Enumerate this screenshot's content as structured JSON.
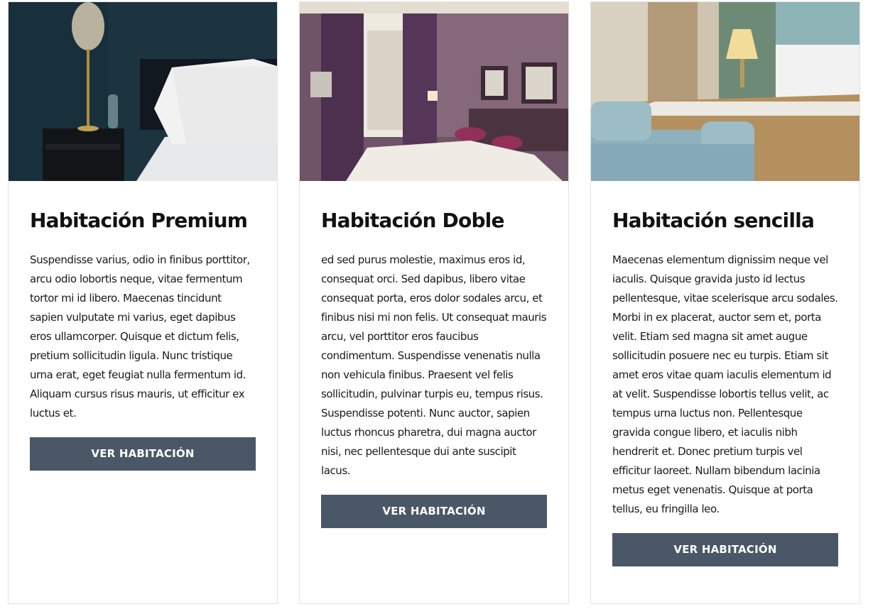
{
  "rooms": [
    {
      "title": "Habitación Premium",
      "description": "Suspendisse varius, odio in finibus porttitor, arcu odio lobortis neque, vitae fermentum tortor mi id libero. Maecenas tincidunt sapien vulputate mi varius, eget dapibus eros ullamcorper. Quisque et dictum felis, pretium sollicitudin ligula. Nunc tristique urna erat, eget feugiat nulla fermentum id. Aliquam cursus risus mauris, ut efficitur ex luctus et.",
      "button_label": "VER HABITACIÓN",
      "image": "dark-bedroom-with-lamp-and-pillows"
    },
    {
      "title": "Habitación Doble",
      "description": "ed sed purus molestie, maximus eros id, consequat orci. Sed dapibus, libero vitae consequat porta, eros dolor sodales arcu, et finibus nisi mi non felis. Ut consequat mauris arcu, vel porttitor eros faucibus condimentum. Suspendisse venenatis nulla non vehicula finibus. Praesent vel felis sollicitudin, pulvinar turpis eu, tempus risus. Suspendisse potenti. Nunc auctor, sapien luctus rhoncus pharetra, dui magna auctor nisi, nec pellentesque dui ante suscipit lacus.",
      "button_label": "VER HABITACIÓN",
      "image": "purple-hotel-room-with-window"
    },
    {
      "title": "Habitación sencilla",
      "description": "Maecenas elementum dignissim neque vel iaculis. Quisque gravida justo id lectus pellentesque, vitae scelerisque arcu sodales. Morbi in ex placerat, auctor sem et, porta velit. Etiam sed magna sit amet augue sollicitudin posuere nec eu turpis. Etiam sit amet eros vitae quam iaculis elementum id at velit. Suspendisse lobortis tellus velit, ac tempus urna luctus non. Pellentesque gravida congue libero, et iaculis nibh hendrerit et. Donec pretium turpis vel efficitur laoreet. Nullam bibendum lacinia metus eget venenatis. Quisque at porta tellus, eu fringilla leo.",
      "button_label": "VER HABITACIÓN",
      "image": "bedroom-with-blue-sofa"
    }
  ],
  "colors": {
    "button_bg": "#4a5767",
    "button_text": "#ffffff",
    "card_border": "#e2e2e2",
    "title": "#111111"
  }
}
